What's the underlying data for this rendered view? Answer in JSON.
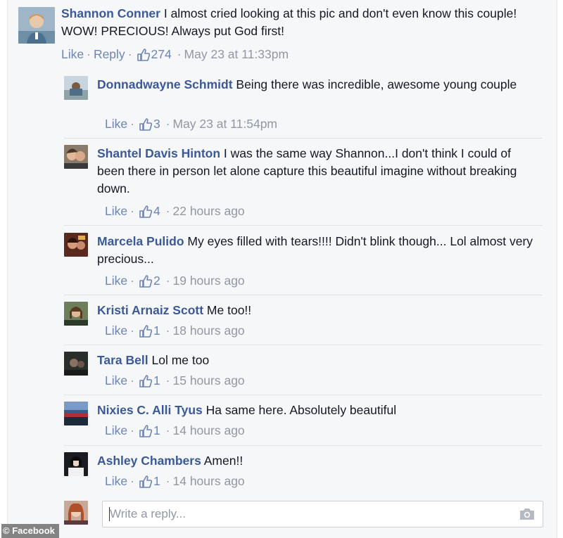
{
  "main_comment": {
    "author": "Shannon Conner",
    "text": "I almost cried looking at this pic and don't even know this couple! WOW! PRECIOUS! Always put God first!",
    "like_label": "Like",
    "reply_label": "Reply",
    "likes": "274",
    "timestamp": "May 23 at 11:33pm"
  },
  "replies": [
    {
      "author": "Donnadwayne Schmidt",
      "text": "Being there was incredible, awesome young couple",
      "like_label": "Like",
      "likes": "3",
      "timestamp": "May 23 at 11:54pm"
    },
    {
      "author": "Shantel Davis Hinton",
      "text": "I was the same way Shannon...I don't think I could of been there in person let alone capture this beautiful imagine without breaking down.",
      "like_label": "Like",
      "likes": "4",
      "timestamp": "22 hours ago"
    },
    {
      "author": "Marcela Pulido",
      "text": "My eyes filled with tears!!!! Didn't blink though... Lol almost very precious...",
      "like_label": "Like",
      "likes": "2",
      "timestamp": "19 hours ago"
    },
    {
      "author": "Kristi Arnaiz Scott",
      "text": "Me too!!",
      "like_label": "Like",
      "likes": "1",
      "timestamp": "18 hours ago"
    },
    {
      "author": "Tara Bell",
      "text": "Lol me too",
      "like_label": "Like",
      "likes": "1",
      "timestamp": "15 hours ago"
    },
    {
      "author": "Nixies C. Alli Tyus",
      "text": "Ha same here. Absolutely beautiful",
      "like_label": "Like",
      "likes": "1",
      "timestamp": "14 hours ago"
    },
    {
      "author": "Ashley Chambers",
      "text": "Amen!!",
      "like_label": "Like",
      "likes": "1",
      "timestamp": "14 hours ago"
    }
  ],
  "reply_input": {
    "placeholder": "Write a reply..."
  },
  "credit": "© Facebook",
  "icons": {
    "like": "thumbs-up-icon",
    "camera": "camera-icon"
  },
  "colors": {
    "author": "#3b5998",
    "link": "#6d84b4",
    "meta": "#9197a3",
    "background": "#f6f7f9"
  }
}
